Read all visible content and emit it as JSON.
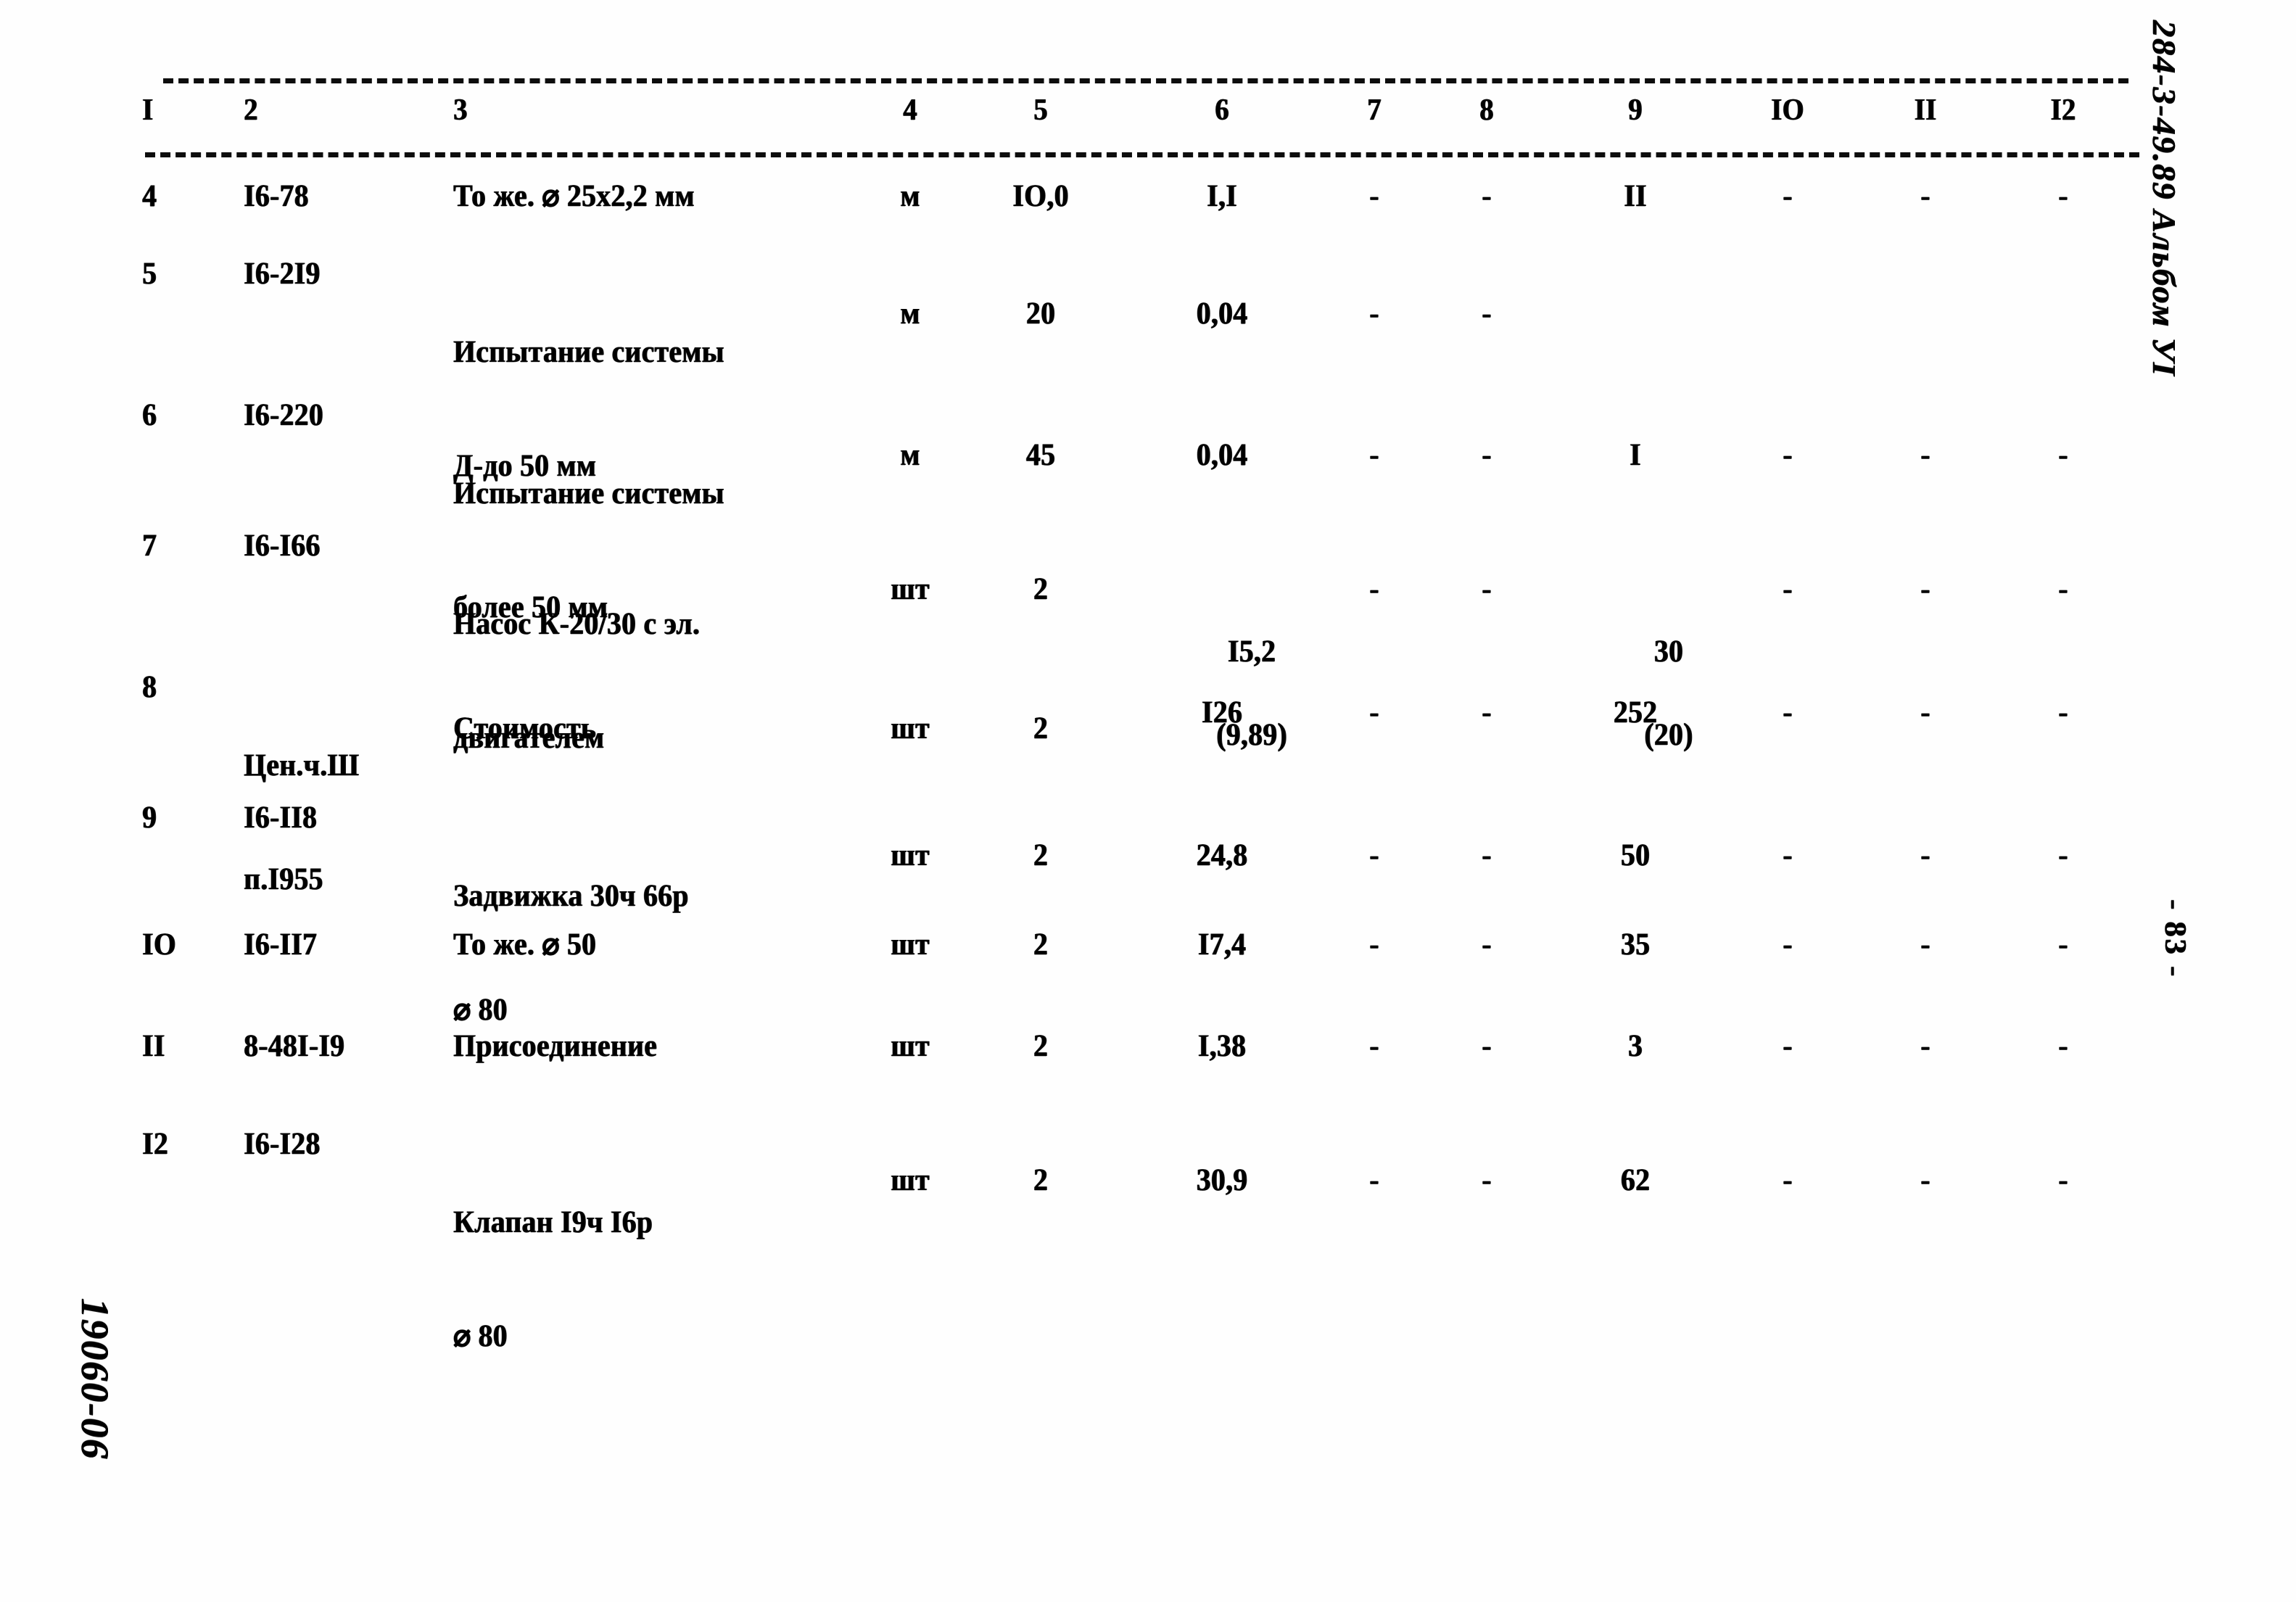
{
  "document": {
    "margin_right_top": "284-3-49.89 Альбом УI",
    "margin_right_page": "- 83 -",
    "margin_left_bottom": "19060-06"
  },
  "table": {
    "headers": [
      "I",
      "2",
      "3",
      "4",
      "5",
      "6",
      "7",
      "8",
      "9",
      "IO",
      "II",
      "I2"
    ],
    "rows": [
      {
        "c1": "4",
        "c2": "I6-78",
        "c3": "То же. ⌀ 25х2,2 мм",
        "c3b": "",
        "c4": "м",
        "c5": "IO,0",
        "c6": "I,I",
        "c6b": "",
        "c7": "-",
        "c8": "-",
        "c9": "II",
        "c9b": "",
        "c10": "-",
        "c11": "-",
        "c12": "-"
      },
      {
        "c1": "5",
        "c2": "I6-2I9",
        "c3": "Испытание системы",
        "c3b": "Д-до 50 мм",
        "c4": "м",
        "c5": "20",
        "c6": "0,04",
        "c6b": "",
        "c7": "-",
        "c8": "-",
        "c9": "",
        "c9b": "",
        "c10": "",
        "c11": "",
        "c12": ""
      },
      {
        "c1": "6",
        "c2": "I6-220",
        "c3": "Испытание системы",
        "c3b": "более 50 мм",
        "c4": "м",
        "c5": "45",
        "c6": "0,04",
        "c6b": "",
        "c7": "-",
        "c8": "-",
        "c9": "I",
        "c9b": "",
        "c10": "-",
        "c11": "-",
        "c12": "-"
      },
      {
        "c1": "7",
        "c2": "I6-I66",
        "c3": "Насос К-20/30 с эл.",
        "c3b": "двигателем",
        "c4": "шт",
        "c5": "2",
        "c6": "I5,2",
        "c6b": "(9,89)",
        "c7": "-",
        "c8": "-",
        "c9": "30",
        "c9b": "(20)",
        "c10": "-",
        "c11": "-",
        "c12": "-"
      },
      {
        "c1": "8",
        "c2": "Цен.ч.Ш",
        "c2b": "п.I955",
        "c3": "Стоимость",
        "c3b": "",
        "c4": "шт",
        "c5": "2",
        "c6": "I26",
        "c6b": "",
        "c7": "-",
        "c8": "-",
        "c9": "252",
        "c9b": "",
        "c10": "-",
        "c11": "-",
        "c12": "-"
      },
      {
        "c1": "9",
        "c2": "I6-II8",
        "c3": "Задвижка 30ч 66р",
        "c3b": "⌀ 80",
        "c4": "шт",
        "c5": "2",
        "c6": "24,8",
        "c6b": "",
        "c7": "-",
        "c8": "-",
        "c9": "50",
        "c9b": "",
        "c10": "-",
        "c11": "-",
        "c12": "-"
      },
      {
        "c1": "IO",
        "c2": "I6-II7",
        "c3": "То же. ⌀ 50",
        "c3b": "",
        "c4": "шт",
        "c5": "2",
        "c6": "I7,4",
        "c6b": "",
        "c7": "-",
        "c8": "-",
        "c9": "35",
        "c9b": "",
        "c10": "-",
        "c11": "-",
        "c12": "-"
      },
      {
        "c1": "II",
        "c2": "8-48I-I9",
        "c3": "Присоединение",
        "c3b": "",
        "c4": "шт",
        "c5": "2",
        "c6": "I,38",
        "c6b": "",
        "c7": "-",
        "c8": "-",
        "c9": "3",
        "c9b": "",
        "c10": "-",
        "c11": "-",
        "c12": "-"
      },
      {
        "c1": "I2",
        "c2": "I6-I28",
        "c3": "Клапан I9ч I6р",
        "c3b": "⌀ 80",
        "c4": "шт",
        "c5": "2",
        "c6": "30,9",
        "c6b": "",
        "c7": "-",
        "c8": "-",
        "c9": "62",
        "c9b": "",
        "c10": "-",
        "c11": "-",
        "c12": "-"
      }
    ]
  }
}
